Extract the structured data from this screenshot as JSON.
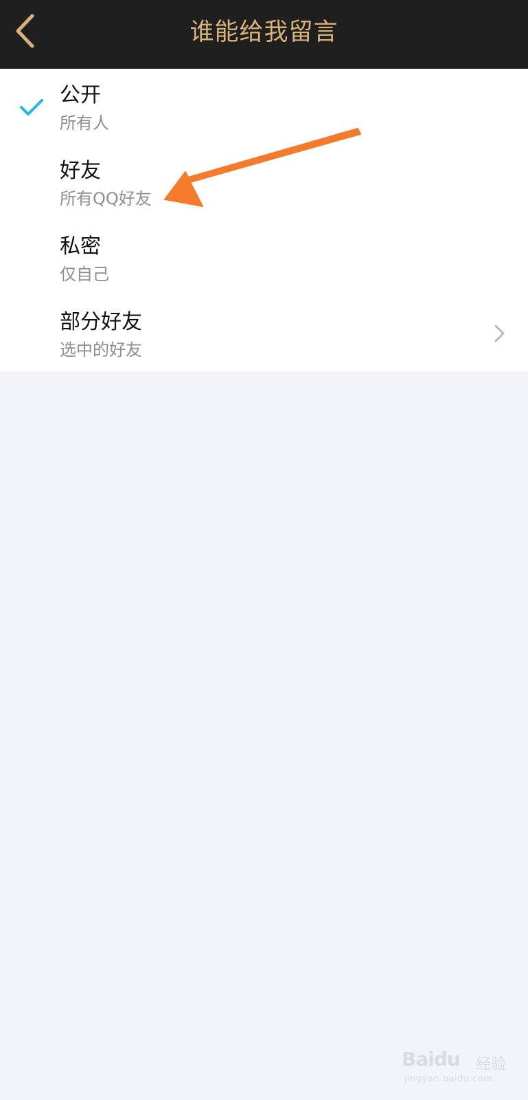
{
  "header": {
    "title": "谁能给我留言",
    "back_icon": "chevron-left-icon"
  },
  "options": [
    {
      "title": "公开",
      "subtitle": "所有人",
      "selected": true
    },
    {
      "title": "好友",
      "subtitle": "所有QQ好友",
      "selected": false
    },
    {
      "title": "私密",
      "subtitle": "仅自己",
      "selected": false
    },
    {
      "title": "部分好友",
      "subtitle": "选中的好友",
      "selected": false,
      "has_detail": true
    }
  ],
  "watermark": {
    "logo": "Baidu",
    "text": "经验",
    "url": "jingyan.baidu.com"
  },
  "colors": {
    "header_bg": "#1f1f1f",
    "header_text": "#d8b377",
    "check": "#1fb6ea",
    "arrow": "#f47a2c",
    "page_bg": "#f3f4f8"
  }
}
